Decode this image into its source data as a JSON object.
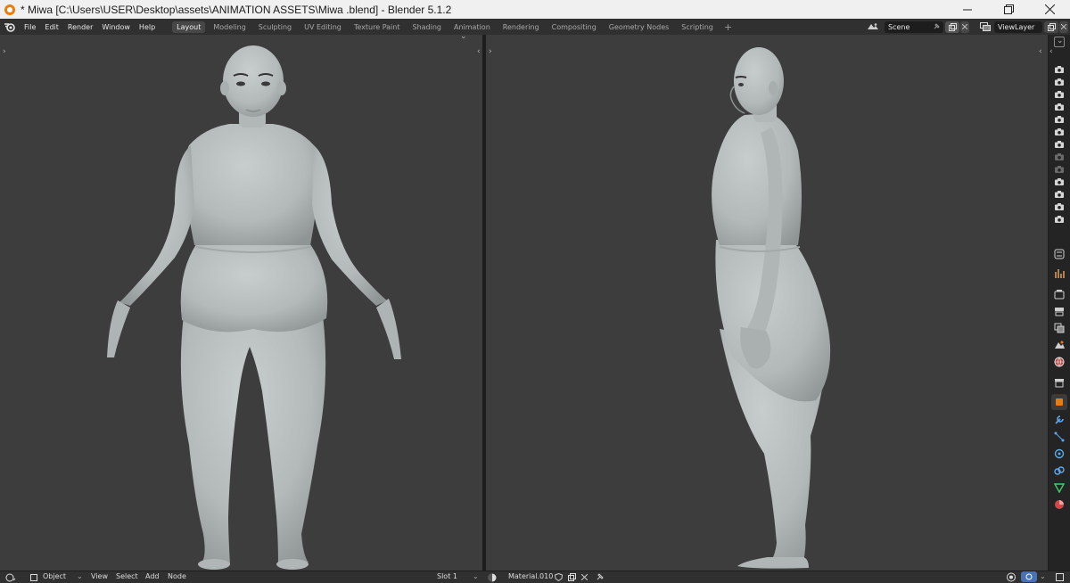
{
  "window": {
    "title": "* Miwa  [C:\\Users\\USER\\Desktop\\assets\\ANIMATION ASSETS\\Miwa .blend] - Blender 5.1.2"
  },
  "menu": {
    "items": [
      "File",
      "Edit",
      "Render",
      "Window",
      "Help"
    ]
  },
  "workspaces": {
    "tabs": [
      "Layout",
      "Modeling",
      "Sculpting",
      "UV Editing",
      "Texture Paint",
      "Shading",
      "Animation",
      "Rendering",
      "Compositing",
      "Geometry Nodes",
      "Scripting"
    ],
    "active": "Layout",
    "add_symbol": "+"
  },
  "scene": {
    "name": "Scene"
  },
  "view_layer": {
    "name": "ViewLayer"
  },
  "bottom": {
    "mode": "Object",
    "view": "View",
    "select": "Select",
    "add": "Add",
    "node": "Node",
    "slot": "Slot 1",
    "material": "Material.010"
  },
  "colors": {
    "accent_orange": "#e87d0d",
    "viewport_bg": "#3d3d3d",
    "header_bg": "#303030",
    "model_grey": "#b9bfbf"
  },
  "icons": {
    "app": "blender-logo-icon",
    "minimize": "minimize-icon",
    "maximize": "restore-icon",
    "close": "close-icon"
  }
}
